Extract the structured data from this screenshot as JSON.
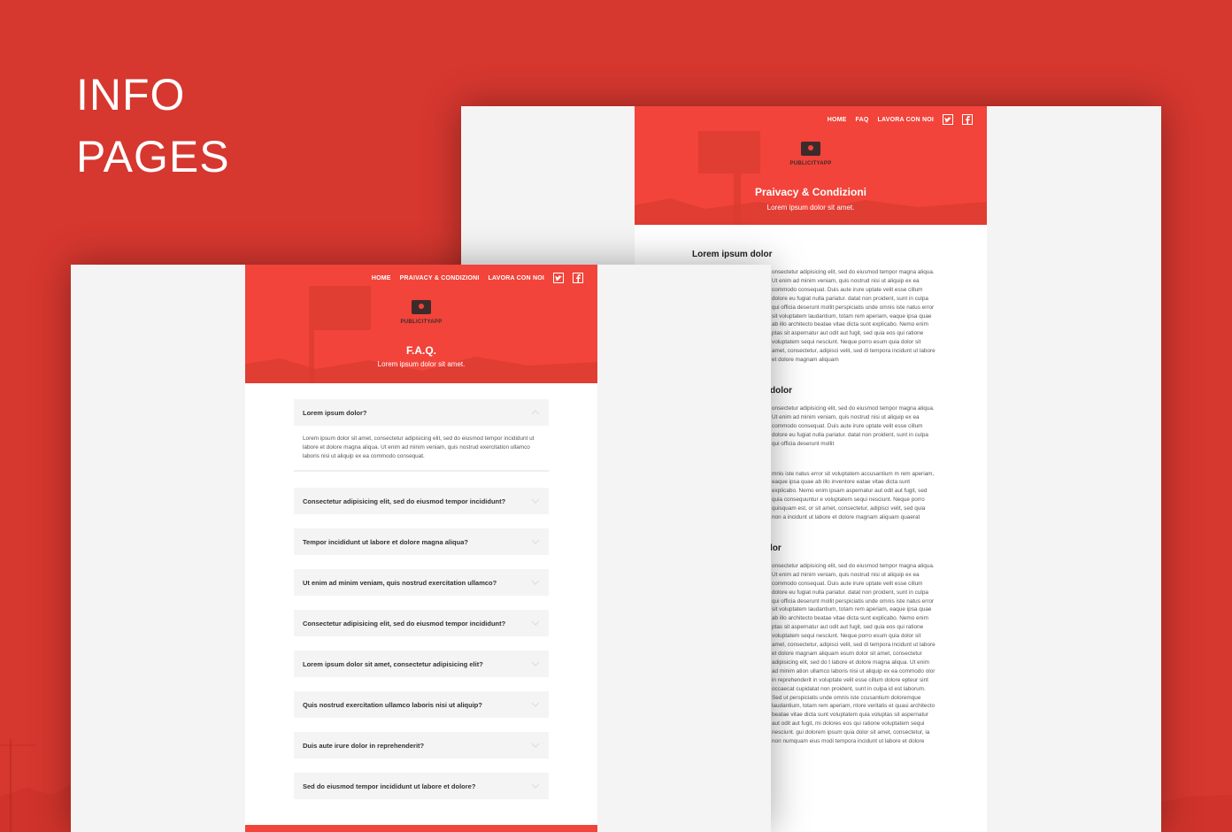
{
  "hero": {
    "line1": "INFO",
    "line2": "PAGES"
  },
  "colors": {
    "background": "#d6372f",
    "brand": "#f2443a",
    "frame": "#f4f4f4"
  },
  "brand_logo": {
    "text": "PUBLICITYAPP",
    "icon": "billboard-logo-icon"
  },
  "back_page": {
    "nav": [
      "HOME",
      "FAQ",
      "LAVORA CON NOI"
    ],
    "title": "Praivacy & Condizioni",
    "subtitle": "Lorem ipsum dolor sit amet.",
    "sections": [
      {
        "heading": "Lorem ipsum dolor",
        "text": "onsectetur adipisicing elit, sed do eiusmod tempor magna aliqua. Ut enim ad minim veniam, quis nostrud nisi ut aliquip ex ea commodo consequat. Duis aute irure uptate velit esse cillum dolore eu fugiat nulla pariatur. datat non proident, sunt in culpa qui officia deserunt mollit perspiciatis unde omnis iste natus error sit voluptatem laudantium, totam rem aperiam, eaque ipsa quae ab illo architecto beatae vitae dicta sunt explicabo. Nemo enim ptas sit aspernatur aut odit aut fugit, sed quia eos qui ratione voluptatem sequi nesciunt. Neque porro esum quia dolor sit amet, consectetur, adipisci velit, sed di tempora incidunt ut labore et dolore magnam aliquam"
      },
      {
        "heading": "dolor",
        "text": "onsectetur adipisicing elit, sed do eiusmod tempor magna aliqua. Ut enim ad minim veniam, quis nostrud nisi ut aliquip ex ea commodo consequat. Duis aute irure uptate velit esse cillum dolore eu fugiat nulla pariatur. datat non proident, sunt in culpa qui officia deserunt mollit"
      },
      {
        "heading": "",
        "text": "mnis iste natus error sit voluptatem accusantium m rem aperiam, eaque ipsa quae ab illo inventore eatae vitae dicta sunt explicabo. Nemo enim ipsam aspernatur aut odit aut fugit, sed quia consequuntur e voluptatem sequi nesciunt. Neque porro quisquam est, or sit amet, consectetur, adipisci velit, sed quia non a incidunt ut labore et dolore magnam aliquam quaerat"
      },
      {
        "heading": "lor",
        "text": "onsectetur adipisicing elit, sed do eiusmod tempor magna aliqua. Ut enim ad minim veniam, quis nostrud nisi ut aliquip ex ea commodo consequat. Duis aute irure uptate velit esse cillum dolore eu fugiat nulla pariatur. datat non proident, sunt in culpa qui officia deserunt mollit perspiciatis unde omnis iste natus error sit voluptatem laudantium, totam rem aperiam, eaque ipsa quae ab illo architecto beatae vitae dicta sunt explicabo. Nemo enim ptas sit aspernatur aut odit aut fugit, sed quia eos qui ratione voluptatem sequi nesciunt. Neque porro esum quia dolor sit amet, consectetur, adipisci velit, sed di tempora incidunt ut labore et dolore magnam aliquam esum dolor sit amet, consectetur adipisicing elit, sed do t labore et dolore magna aliqua. Ut enim ad minim ation ullamco laboris nisi ut aliquip ex ea commodo olor in reprehenderit in voluptate velit esse cillum dolore epteur sint occaecat cupidatat non proident, sunt in culpa id est laborum. Sed ut perspiciatis unde omnis iste ccusantium doloremque laudantium, totam rem aperiam, ntore veritatis et quasi architecto beatae vitae dicta sunt voluptatem quia voluptas sit aspernatur aut odit aut fugit, mi dolores eos qui ratione voluptatem sequi nesciunt. gui dolorem ipsum quia dolor sit amet, consectetur, ia non numquam eius modi tempora incidunt ut labore et dolore"
      }
    ]
  },
  "front_page": {
    "nav": [
      "HOME",
      "PRAIVACY & CONDIZIONI",
      "LAVORA CON NOI"
    ],
    "title": "F.A.Q.",
    "subtitle": "Lorem ipsum dolor sit amet.",
    "faq_open": {
      "question": "Lorem ipsum dolor?",
      "answer": "Lorem ipsum dolor sit amet, consectetur adipisicing elit, sed do eiusmod tempor incididunt ut labore et dolore magna aliqua. Ut enim ad minim veniam, quis nostrud exercitation ullamco laboris nisi ut aliquip ex ea commodo consequat."
    },
    "faq_items": [
      "Consectetur adipisicing elit, sed do eiusmod tempor incididunt?",
      "Tempor incididunt ut labore et dolore magna aliqua?",
      "Ut enim ad minim veniam, quis nostrud exercitation ullamco?",
      "Consectetur adipisicing elit, sed do eiusmod tempor incididunt?",
      "Lorem ipsum dolor sit amet, consectetur adipisicing elit?",
      "Quis nostrud exercitation ullamco laboris nisi ut aliquip?",
      "Duis aute irure dolor in reprehenderit?",
      "Sed do eiusmod tempor incididunt ut labore et dolore?"
    ]
  }
}
